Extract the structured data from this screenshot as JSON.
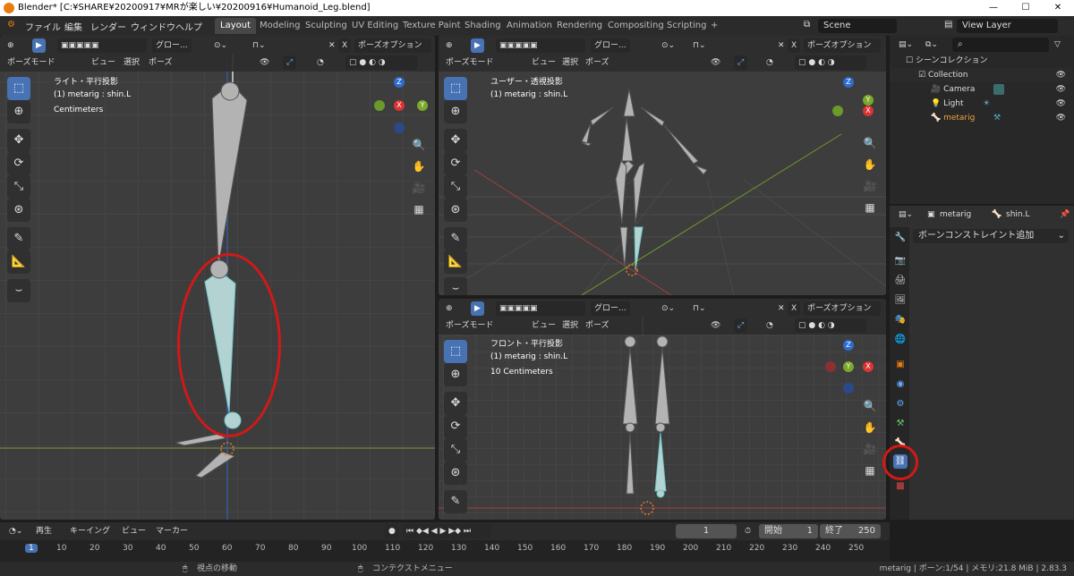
{
  "window": {
    "title": "Blender* [C:¥SHARE¥20200917¥MRが楽しい¥20200916¥Humanoid_Leg.blend]",
    "min": "—",
    "max": "☐",
    "close": "✕"
  },
  "menus": [
    "ファイル",
    "編集",
    "レンダー",
    "ウィンドウ",
    "ヘルプ"
  ],
  "workspaces": [
    "Layout",
    "Modeling",
    "Sculpting",
    "UV Editing",
    "Texture Paint",
    "Shading",
    "Animation",
    "Rendering",
    "Compositing",
    "Scripting",
    "+"
  ],
  "scene": "Scene",
  "view_layer": "View Layer",
  "viewport_header": {
    "mode": "ポーズモード",
    "view": "ビュー",
    "select": "選択",
    "pose": "ポーズ",
    "transform": "グロー...",
    "pose_options": "ポーズオプション"
  },
  "viewports": [
    {
      "name": "ライト・平行投影",
      "object": "(1) metarig : shin.L",
      "units": "Centimeters"
    },
    {
      "name": "ユーザー・透視投影",
      "object": "(1) metarig : shin.L",
      "units": ""
    },
    {
      "name": "フロント・平行投影",
      "object": "(1) metarig : shin.L",
      "units": "10 Centimeters"
    }
  ],
  "gizmo": {
    "x": "X",
    "y": "Y",
    "z": "Z"
  },
  "outliner": {
    "title": "シーンコレクション",
    "collection": "Collection",
    "items": [
      "Camera",
      "Light",
      "metarig"
    ]
  },
  "properties": {
    "object": "metarig",
    "bone": "shin.L",
    "add_constraint": "ボーンコンストレイント追加"
  },
  "timeline": {
    "play": "再生",
    "keying": "キーイング",
    "view": "ビュー",
    "marker": "マーカー",
    "current": "1",
    "start_label": "開始",
    "start": "1",
    "end_label": "終了",
    "end": "250",
    "ticks": [
      "1",
      "10",
      "20",
      "30",
      "40",
      "50",
      "60",
      "70",
      "80",
      "90",
      "100",
      "110",
      "120",
      "130",
      "140",
      "150",
      "160",
      "170",
      "180",
      "190",
      "200",
      "210",
      "220",
      "230",
      "240",
      "250"
    ]
  },
  "status": {
    "left": "視点の移動",
    "middle": "コンテクストメニュー",
    "right": "metarig | ボーン:1/54 | メモリ:21.8 MiB | 2.83.3"
  },
  "colors": {
    "accent": "#4772b3",
    "highlight": "#d31818",
    "bone_selected": "#a8d8d8"
  }
}
